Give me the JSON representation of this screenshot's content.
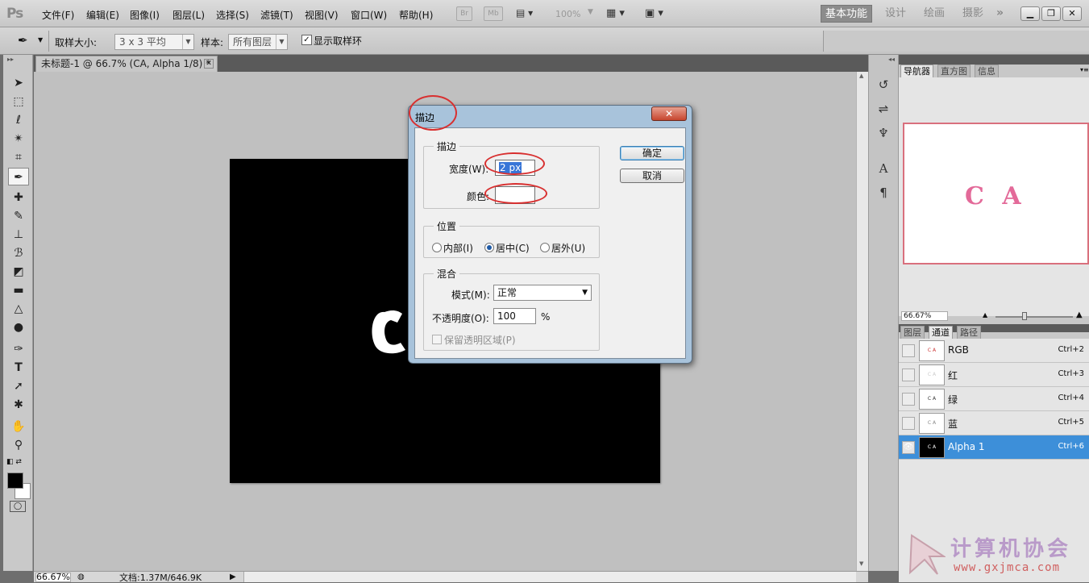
{
  "app": {
    "logo": "Ps"
  },
  "menu": [
    "文件(F)",
    "编辑(E)",
    "图像(I)",
    "图层(L)",
    "选择(S)",
    "滤镜(T)",
    "视图(V)",
    "窗口(W)",
    "帮助(H)"
  ],
  "appbar": {
    "br": "Br",
    "mb": "Mb",
    "zoom": "100%"
  },
  "workspaces": [
    "基本功能",
    "设计",
    "绘画",
    "摄影"
  ],
  "options": {
    "sample_size_label": "取样大小:",
    "sample_size_value": "3 x 3 平均",
    "sample_label": "样本:",
    "sample_value": "所有图层",
    "show_ring_label": "显示取样环"
  },
  "document": {
    "tab_title": "未标题-1 @ 66.7% (CA, Alpha 1/8) *",
    "zoom": "66.67%",
    "doc_info": "文档:1.37M/646.9K"
  },
  "navigator": {
    "tabs": [
      "导航器",
      "直方图",
      "信息"
    ],
    "preview_text": "C A",
    "zoom": "66.67%"
  },
  "channels": {
    "tabs": [
      "图层",
      "通道",
      "路径"
    ],
    "rows": [
      {
        "name": "RGB",
        "shortcut": "Ctrl+2"
      },
      {
        "name": "红",
        "shortcut": "Ctrl+3"
      },
      {
        "name": "绿",
        "shortcut": "Ctrl+4"
      },
      {
        "name": "蓝",
        "shortcut": "Ctrl+5"
      },
      {
        "name": "Alpha 1",
        "shortcut": "Ctrl+6"
      }
    ]
  },
  "dialog": {
    "title": "描边",
    "stroke_group": "描边",
    "width_label": "宽度(W):",
    "width_value": "2 px",
    "color_label": "颜色:",
    "position_group": "位置",
    "position_options": [
      "内部(I)",
      "居中(C)",
      "居外(U)"
    ],
    "position_selected": "居中(C)",
    "blend_group": "混合",
    "mode_label": "模式(M):",
    "mode_value": "正常",
    "opacity_label": "不透明度(O):",
    "opacity_value": "100",
    "opacity_unit": "%",
    "preserve_label": "保留透明区域(P)",
    "ok": "确定",
    "cancel": "取消"
  },
  "watermark": {
    "text": "计算机协会",
    "url": "www.gxjmca.com"
  },
  "colors": {
    "selection": "#3d8fd9",
    "annotation": "#d83030",
    "nav_border": "#d9707d"
  }
}
